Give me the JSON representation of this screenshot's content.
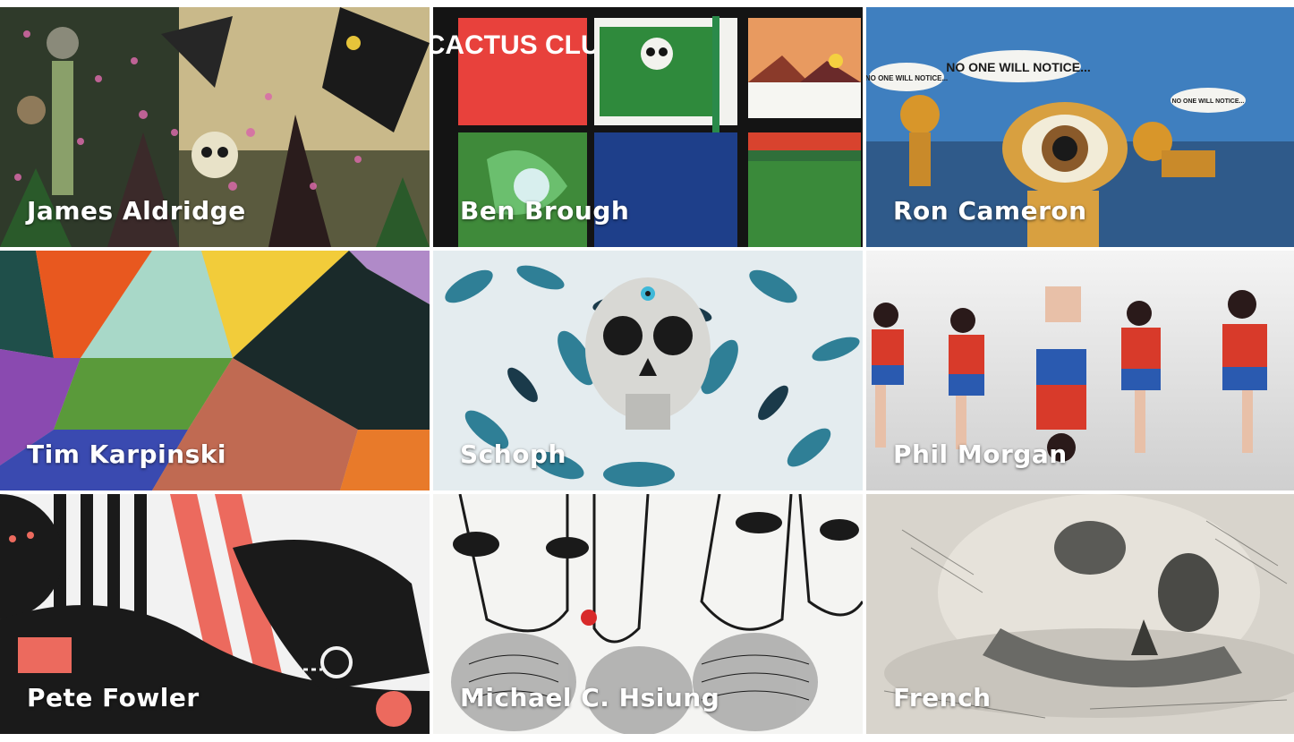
{
  "artists": [
    {
      "name": "James Aldridge",
      "art": "dark-jungle-skull-illustration"
    },
    {
      "name": "Ben Brough",
      "art": "cactus-club-flag-painting"
    },
    {
      "name": "Ron Cameron",
      "art": "cyclops-cats-painting"
    },
    {
      "name": "Tim Karpinski",
      "art": "geometric-triangles-paper"
    },
    {
      "name": "Schoph",
      "art": "skull-leaves-mural"
    },
    {
      "name": "Phil Morgan",
      "art": "dancing-athletes-illustration"
    },
    {
      "name": "Pete Fowler",
      "art": "abstract-stripes-illustration"
    },
    {
      "name": "Michael C. Hsiung",
      "art": "bearded-faces-line-drawing"
    },
    {
      "name": "French",
      "art": "skull-pencil-sketch"
    }
  ],
  "speech_bubbles": [
    "NO ONE WILL NOTICE...",
    "NO ONE WILL NOTICE...",
    "NO ONE WILL NOTICE..."
  ],
  "sign_text": "CACTUS CLUB"
}
